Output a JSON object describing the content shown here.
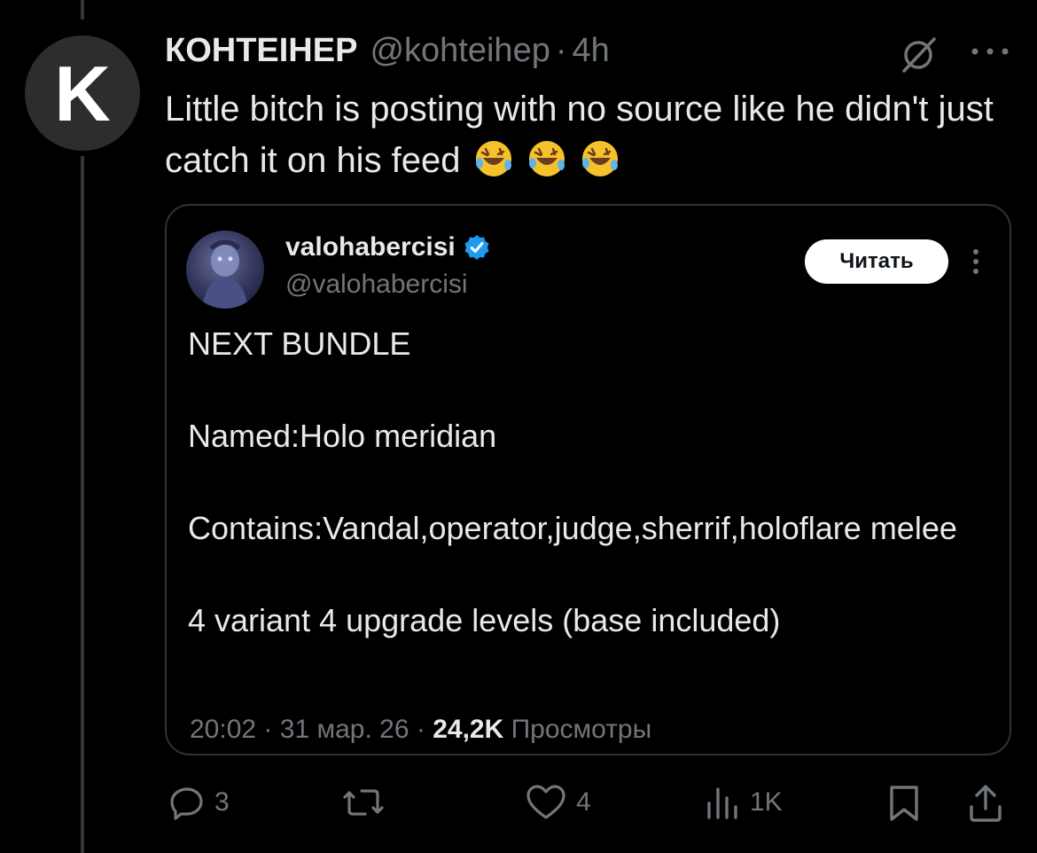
{
  "tweet": {
    "avatar_letter": "K",
    "display_name": "КОНТЕІНЕР",
    "handle": "@kohteihep",
    "separator": "·",
    "time": "4h",
    "text": "Little bitch is posting with no source like he didn't just catch it on his feed",
    "emoji": [
      "rolling-on-floor-laughing",
      "rolling-on-floor-laughing",
      "rolling-on-floor-laughing"
    ]
  },
  "quote": {
    "display_name": "valohabercisi",
    "handle": "@valohabercisi",
    "follow_label": "Читать",
    "lines": [
      "NEXT BUNDLE",
      "",
      "Named:Holo meridian",
      "",
      "Contains:Vandal,operator,judge,sherrif,holoflare melee",
      "",
      "4 variant 4 upgrade levels (base included)"
    ],
    "time": "20:02",
    "date": "31 мар. 26",
    "views_count": "24,2K",
    "views_label": "Просмотры",
    "sep": "·"
  },
  "actions": {
    "replies": "3",
    "retweets": "",
    "likes": "4",
    "views": "1K"
  },
  "colors": {
    "background": "#000000",
    "text": "#e7e9ea",
    "muted": "#71767b",
    "border": "#2f3336",
    "verified": "#1d9bf0"
  }
}
